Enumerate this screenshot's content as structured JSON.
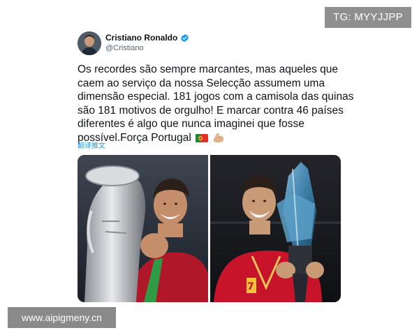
{
  "overlay": {
    "tg_badge": "TG: MYYJJPP",
    "site_watermark": "www.aipigmeny.cn"
  },
  "tweet": {
    "author": {
      "display_name": "Cristiano Ronaldo",
      "handle": "@Cristiano",
      "verified": true
    },
    "text": "Os recordes são sempre marcantes, mas aqueles que caem ao serviço da nossa Selecção assumem uma dimensão especial. 181 jogos com a camisola das quinas são 181 motivos de orgulho! E marcar contra 46 países diferentes é algo que nunca imaginei que fosse possível.Força Portugal",
    "emojis": [
      "portugal-flag-icon",
      "flexed-biceps-icon"
    ],
    "translate_link": "翻译推文",
    "media": [
      {
        "description_icon": "euro-trophy-photo"
      },
      {
        "description_icon": "nations-league-trophy-photo"
      }
    ]
  },
  "colors": {
    "link_blue": "#1d9bf0",
    "verified_blue": "#1d9bf0",
    "text_primary": "#0f1419",
    "text_secondary": "#536471"
  }
}
